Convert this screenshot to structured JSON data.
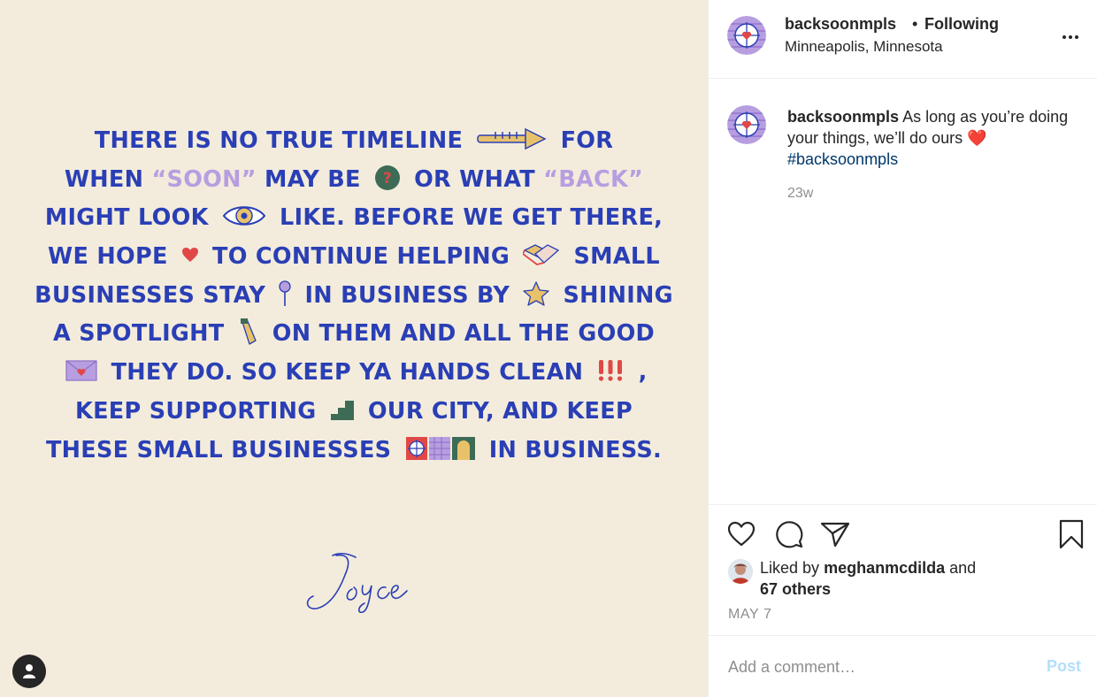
{
  "post_image": {
    "poem_lines": [
      {
        "segments": [
          {
            "text": "THERE IS NO TRUE TIMELINE"
          },
          {
            "emoji": "arrow-icon"
          },
          {
            "text": "FOR"
          }
        ]
      },
      {
        "segments": [
          {
            "text": "WHEN"
          },
          {
            "text": "“SOON”",
            "highlight": true
          },
          {
            "text": "MAY BE"
          },
          {
            "emoji": "question-icon"
          },
          {
            "text": "OR WHAT"
          },
          {
            "text": "“BACK”",
            "highlight": true
          }
        ]
      },
      {
        "segments": [
          {
            "text": "MIGHT  LOOK"
          },
          {
            "emoji": "eye-icon"
          },
          {
            "text": "LIKE.   BEFORE WE GET THERE,"
          }
        ]
      },
      {
        "segments": [
          {
            "text": "WE  HOPE"
          },
          {
            "emoji": "heart-icon"
          },
          {
            "text": "TO CONTINUE HELPING"
          },
          {
            "emoji": "handshake-icon"
          },
          {
            "text": "SMALL"
          }
        ]
      },
      {
        "segments": [
          {
            "text": "BUSINESSES STAY"
          },
          {
            "emoji": "pin-icon"
          },
          {
            "text": "IN BUSINESS BY"
          },
          {
            "emoji": "star-icon"
          },
          {
            "text": "SHINING"
          }
        ]
      },
      {
        "segments": [
          {
            "text": "A  SPOTLIGHT"
          },
          {
            "emoji": "flashlight-icon"
          },
          {
            "text": "ON THEM AND ALL THE GOOD"
          }
        ]
      },
      {
        "segments": [
          {
            "emoji": "envelope-icon"
          },
          {
            "text": "THEY DO. SO KEEP YA HANDS CLEAN"
          },
          {
            "emoji": "exclamation-icon"
          },
          {
            "text": ","
          }
        ]
      },
      {
        "segments": [
          {
            "text": "KEEP SUPPORTING"
          },
          {
            "emoji": "stairs-icon"
          },
          {
            "text": "OUR CITY, AND KEEP"
          }
        ]
      },
      {
        "segments": [
          {
            "text": "THESE SMALL BUSINESSES"
          },
          {
            "emoji": "storefront-icon"
          },
          {
            "text": "IN BUSINESS."
          }
        ]
      }
    ],
    "signature": "Joyce",
    "colors": {
      "background": "#f3ecdc",
      "text": "#2a3fb5",
      "highlight": "#b79ee0"
    }
  },
  "header": {
    "username": "backsoonmpls",
    "separator": "•",
    "follow_status": "Following",
    "location": "Minneapolis, Minnesota"
  },
  "caption": {
    "username": "backsoonmpls",
    "text": "As long as you’re doing your things, we’ll do ours ❤️",
    "hashtag": "#backsoonmpls",
    "time_ago": "23w"
  },
  "likes": {
    "prefix": "Liked by",
    "liker": "meghanmcdilda",
    "joiner": "and",
    "others": "67 others"
  },
  "post_date": "MAY 7",
  "comment": {
    "placeholder": "Add a comment…",
    "post_label": "Post"
  }
}
